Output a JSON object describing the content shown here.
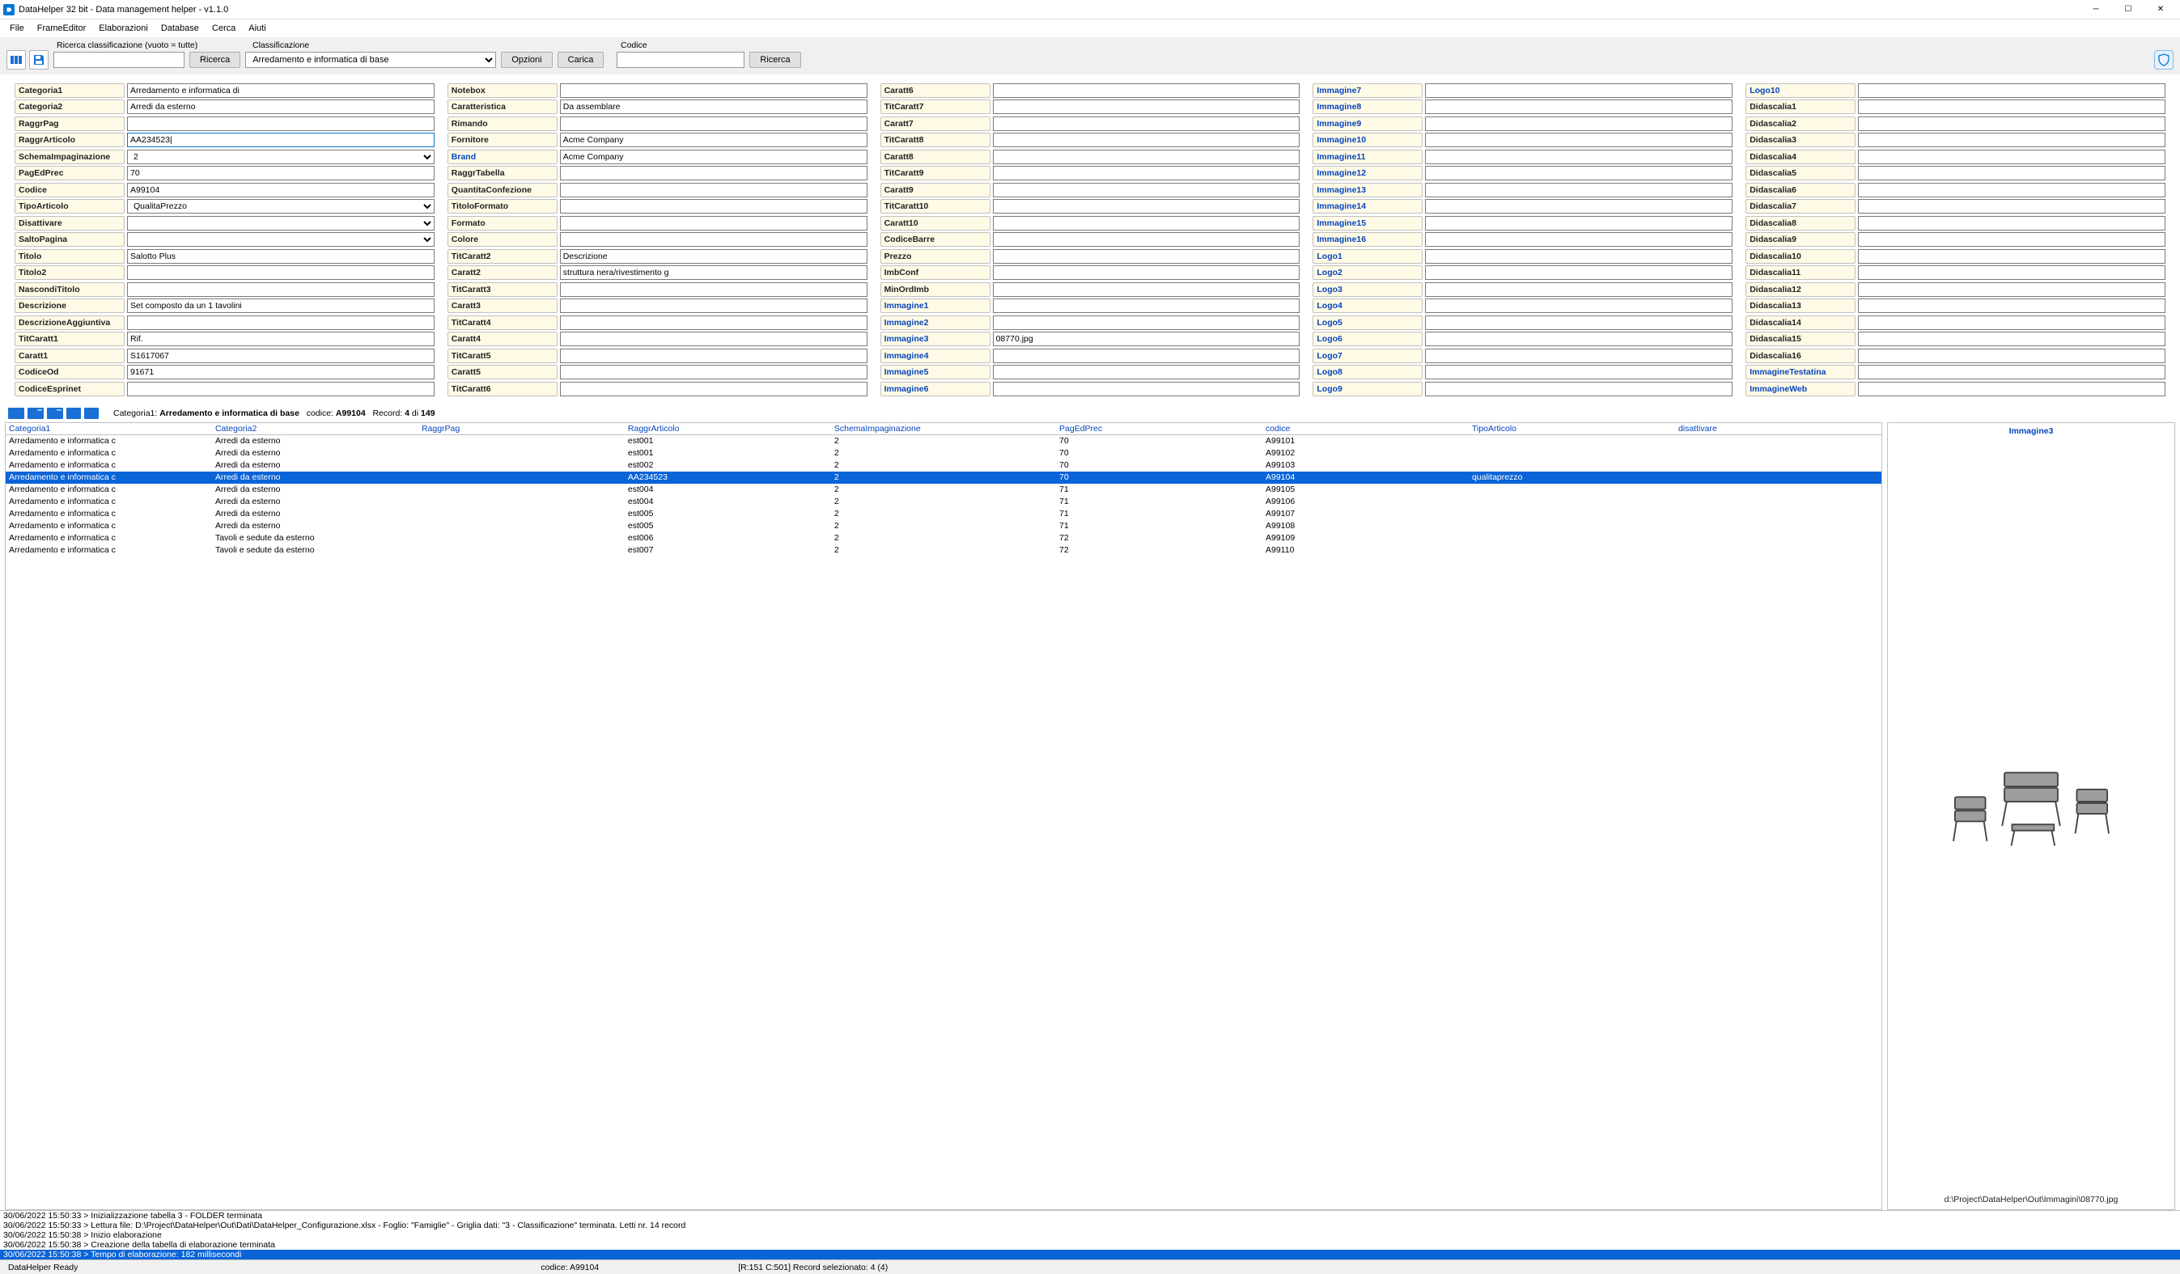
{
  "window": {
    "title": "DataHelper 32 bit - Data management helper - v1.1.0"
  },
  "menubar": [
    "File",
    "FrameEditor",
    "Elaborazioni",
    "Database",
    "Cerca",
    "Aiuti"
  ],
  "toolbar": {
    "label_search": "Ricerca classificazione (vuoto = tutte)",
    "label_class": "Classificazione",
    "label_code": "Codice",
    "btn_ricerca": "Ricerca",
    "select_class": "Arredamento e informatica di base",
    "btn_opzioni": "Opzioni",
    "btn_carica": "Carica",
    "btn_ricerca2": "Ricerca"
  },
  "form": {
    "col1": [
      {
        "label": "Categoria1",
        "value": "Arredamento e informatica di",
        "type": "text"
      },
      {
        "label": "Categoria2",
        "value": "Arredi da esterno",
        "type": "text"
      },
      {
        "label": "RaggrPag",
        "value": "",
        "type": "text"
      },
      {
        "label": "RaggrArticolo",
        "value": "AA234523|",
        "type": "text",
        "focused": true
      },
      {
        "label": "SchemaImpaginazione",
        "value": "2",
        "type": "select"
      },
      {
        "label": "PagEdPrec",
        "value": "70",
        "type": "text"
      },
      {
        "label": "Codice",
        "value": "A99104",
        "type": "text"
      },
      {
        "label": "TipoArticolo",
        "value": "QualitaPrezzo",
        "type": "select"
      },
      {
        "label": "Disattivare",
        "value": "",
        "type": "select"
      },
      {
        "label": "SaltoPagina",
        "value": "",
        "type": "select"
      },
      {
        "label": "Titolo",
        "value": "Salotto Plus",
        "type": "text"
      },
      {
        "label": "Titolo2",
        "value": "",
        "type": "text"
      },
      {
        "label": "NascondiTitolo",
        "value": "",
        "type": "text"
      },
      {
        "label": "Descrizione",
        "value": "Set composto da un 1 tavolini",
        "type": "text"
      },
      {
        "label": "DescrizioneAggiuntiva",
        "value": "",
        "type": "text"
      },
      {
        "label": "TitCaratt1",
        "value": "Rif.",
        "type": "text"
      },
      {
        "label": "Caratt1",
        "value": "S1617067",
        "type": "text"
      },
      {
        "label": "CodiceOd",
        "value": "91671",
        "type": "text"
      },
      {
        "label": "CodiceEsprinet",
        "value": "",
        "type": "text"
      }
    ],
    "col2": [
      {
        "label": "Notebox",
        "value": "",
        "type": "text"
      },
      {
        "label": "Caratteristica",
        "value": "Da assemblare",
        "type": "text"
      },
      {
        "label": "Rimando",
        "value": "",
        "type": "text"
      },
      {
        "label": "Fornitore",
        "value": "Acme Company",
        "type": "text"
      },
      {
        "label": "Brand",
        "value": "Acme Company",
        "type": "text",
        "link": true
      },
      {
        "label": "RaggrTabella",
        "value": "",
        "type": "text"
      },
      {
        "label": "QuantitaConfezione",
        "value": "",
        "type": "text"
      },
      {
        "label": "TitoloFormato",
        "value": "",
        "type": "text"
      },
      {
        "label": "Formato",
        "value": "",
        "type": "text"
      },
      {
        "label": "Colore",
        "value": "",
        "type": "text"
      },
      {
        "label": "TitCaratt2",
        "value": "Descrizione",
        "type": "text"
      },
      {
        "label": "Caratt2",
        "value": "struttura nera/rivestimento g",
        "type": "text"
      },
      {
        "label": "TitCaratt3",
        "value": "",
        "type": "text"
      },
      {
        "label": "Caratt3",
        "value": "",
        "type": "text"
      },
      {
        "label": "TitCaratt4",
        "value": "",
        "type": "text"
      },
      {
        "label": "Caratt4",
        "value": "",
        "type": "text"
      },
      {
        "label": "TitCaratt5",
        "value": "",
        "type": "text"
      },
      {
        "label": "Caratt5",
        "value": "",
        "type": "text"
      },
      {
        "label": "TitCaratt6",
        "value": "",
        "type": "text"
      }
    ],
    "col3": [
      {
        "label": "Caratt6",
        "value": "",
        "type": "text"
      },
      {
        "label": "TitCaratt7",
        "value": "",
        "type": "text"
      },
      {
        "label": "Caratt7",
        "value": "",
        "type": "text"
      },
      {
        "label": "TitCaratt8",
        "value": "",
        "type": "text"
      },
      {
        "label": "Caratt8",
        "value": "",
        "type": "text"
      },
      {
        "label": "TitCaratt9",
        "value": "",
        "type": "text"
      },
      {
        "label": "Caratt9",
        "value": "",
        "type": "text"
      },
      {
        "label": "TitCaratt10",
        "value": "",
        "type": "text"
      },
      {
        "label": "Caratt10",
        "value": "",
        "type": "text"
      },
      {
        "label": "CodiceBarre",
        "value": "",
        "type": "text"
      },
      {
        "label": "Prezzo",
        "value": "",
        "type": "text"
      },
      {
        "label": "ImbConf",
        "value": "",
        "type": "text"
      },
      {
        "label": "MinOrdImb",
        "value": "",
        "type": "text"
      },
      {
        "label": "Immagine1",
        "value": "",
        "type": "text",
        "link": true
      },
      {
        "label": "Immagine2",
        "value": "",
        "type": "text",
        "link": true
      },
      {
        "label": "Immagine3",
        "value": "08770.jpg",
        "type": "text",
        "link": true
      },
      {
        "label": "Immagine4",
        "value": "",
        "type": "text",
        "link": true
      },
      {
        "label": "Immagine5",
        "value": "",
        "type": "text",
        "link": true
      },
      {
        "label": "Immagine6",
        "value": "",
        "type": "text",
        "link": true
      }
    ],
    "col4": [
      {
        "label": "Immagine7",
        "value": "",
        "type": "text",
        "link": true
      },
      {
        "label": "Immagine8",
        "value": "",
        "type": "text",
        "link": true
      },
      {
        "label": "Immagine9",
        "value": "",
        "type": "text",
        "link": true
      },
      {
        "label": "Immagine10",
        "value": "",
        "type": "text",
        "link": true
      },
      {
        "label": "Immagine11",
        "value": "",
        "type": "text",
        "link": true
      },
      {
        "label": "Immagine12",
        "value": "",
        "type": "text",
        "link": true
      },
      {
        "label": "Immagine13",
        "value": "",
        "type": "text",
        "link": true
      },
      {
        "label": "Immagine14",
        "value": "",
        "type": "text",
        "link": true
      },
      {
        "label": "Immagine15",
        "value": "",
        "type": "text",
        "link": true
      },
      {
        "label": "Immagine16",
        "value": "",
        "type": "text",
        "link": true
      },
      {
        "label": "Logo1",
        "value": "",
        "type": "text",
        "link": true
      },
      {
        "label": "Logo2",
        "value": "",
        "type": "text",
        "link": true
      },
      {
        "label": "Logo3",
        "value": "",
        "type": "text",
        "link": true
      },
      {
        "label": "Logo4",
        "value": "",
        "type": "text",
        "link": true
      },
      {
        "label": "Logo5",
        "value": "",
        "type": "text",
        "link": true
      },
      {
        "label": "Logo6",
        "value": "",
        "type": "text",
        "link": true
      },
      {
        "label": "Logo7",
        "value": "",
        "type": "text",
        "link": true
      },
      {
        "label": "Logo8",
        "value": "",
        "type": "text",
        "link": true
      },
      {
        "label": "Logo9",
        "value": "",
        "type": "text",
        "link": true
      }
    ],
    "col5": [
      {
        "label": "Logo10",
        "value": "",
        "type": "text",
        "link": true
      },
      {
        "label": "Didascalia1",
        "value": "",
        "type": "text"
      },
      {
        "label": "Didascalia2",
        "value": "",
        "type": "text"
      },
      {
        "label": "Didascalia3",
        "value": "",
        "type": "text"
      },
      {
        "label": "Didascalia4",
        "value": "",
        "type": "text"
      },
      {
        "label": "Didascalia5",
        "value": "",
        "type": "text"
      },
      {
        "label": "Didascalia6",
        "value": "",
        "type": "text"
      },
      {
        "label": "Didascalia7",
        "value": "",
        "type": "text"
      },
      {
        "label": "Didascalia8",
        "value": "",
        "type": "text"
      },
      {
        "label": "Didascalia9",
        "value": "",
        "type": "text"
      },
      {
        "label": "Didascalia10",
        "value": "",
        "type": "text"
      },
      {
        "label": "Didascalia11",
        "value": "",
        "type": "text"
      },
      {
        "label": "Didascalia12",
        "value": "",
        "type": "text"
      },
      {
        "label": "Didascalia13",
        "value": "",
        "type": "text"
      },
      {
        "label": "Didascalia14",
        "value": "",
        "type": "text"
      },
      {
        "label": "Didascalia15",
        "value": "",
        "type": "text"
      },
      {
        "label": "Didascalia16",
        "value": "",
        "type": "text"
      },
      {
        "label": "ImmagineTestatina",
        "value": "",
        "type": "text",
        "link": true
      },
      {
        "label": "ImmagineWeb",
        "value": "",
        "type": "text",
        "link": true
      }
    ]
  },
  "summary": {
    "prefix": "Categoria1:",
    "category": "Arredamento e informatica di base",
    "code_lbl": "codice:",
    "code": "A99104",
    "record_lbl": "Record:",
    "record_cur": "4",
    "record_of": "di",
    "record_total": "149"
  },
  "grid": {
    "headers": [
      "Categoria1",
      "Categoria2",
      "RaggrPag",
      "RaggrArticolo",
      "SchemaImpaginazione",
      "PagEdPrec",
      "codice",
      "TipoArticolo",
      "disattivare"
    ],
    "rows": [
      [
        "Arredamento e informatica c",
        "Arredi da esterno",
        "",
        "est001",
        "2",
        "70",
        "A99101",
        "",
        ""
      ],
      [
        "Arredamento e informatica c",
        "Arredi da esterno",
        "",
        "est001",
        "2",
        "70",
        "A99102",
        "",
        ""
      ],
      [
        "Arredamento e informatica c",
        "Arredi da esterno",
        "",
        "est002",
        "2",
        "70",
        "A99103",
        "",
        ""
      ],
      [
        "Arredamento e informatica c",
        "Arredi da esterno",
        "",
        "AA234523",
        "2",
        "70",
        "A99104",
        "qualitaprezzo",
        ""
      ],
      [
        "Arredamento e informatica c",
        "Arredi da esterno",
        "",
        "est004",
        "2",
        "71",
        "A99105",
        "",
        ""
      ],
      [
        "Arredamento e informatica c",
        "Arredi da esterno",
        "",
        "est004",
        "2",
        "71",
        "A99106",
        "",
        ""
      ],
      [
        "Arredamento e informatica c",
        "Arredi da esterno",
        "",
        "est005",
        "2",
        "71",
        "A99107",
        "",
        ""
      ],
      [
        "Arredamento e informatica c",
        "Arredi da esterno",
        "",
        "est005",
        "2",
        "71",
        "A99108",
        "",
        ""
      ],
      [
        "Arredamento e informatica c",
        "Tavoli e sedute da esterno",
        "",
        "est006",
        "2",
        "72",
        "A99109",
        "",
        ""
      ],
      [
        "Arredamento e informatica c",
        "Tavoli e sedute da esterno",
        "",
        "est007",
        "2",
        "72",
        "A99110",
        "",
        ""
      ]
    ],
    "selected_index": 3
  },
  "preview": {
    "title": "Immagine3",
    "path": "d:\\Project\\DataHelper\\Out\\Immagini\\08770.jpg"
  },
  "log": [
    "30/06/2022 15:50:33 > Inizializzazione tabella 3 - FOLDER terminata",
    "30/06/2022 15:50:33 > Lettura file: D:\\Project\\DataHelper\\Out\\Dati\\DataHelper_Configurazione.xlsx - Foglio: \"Famiglie\" - Griglia dati: \"3 - Classificazione\" terminata. Letti nr. 14 record",
    "30/06/2022 15:50:38 > Inizio elaborazione",
    "30/06/2022 15:50:38 > Creazione della tabella di elaborazione terminata",
    "30/06/2022 15:50:38 > Tempo di elaborazione: 182 millisecondi"
  ],
  "status": {
    "ready": "DataHelper Ready",
    "code": "codice: A99104",
    "selection": "[R:151 C:501] Record selezionato: 4 (4)"
  }
}
